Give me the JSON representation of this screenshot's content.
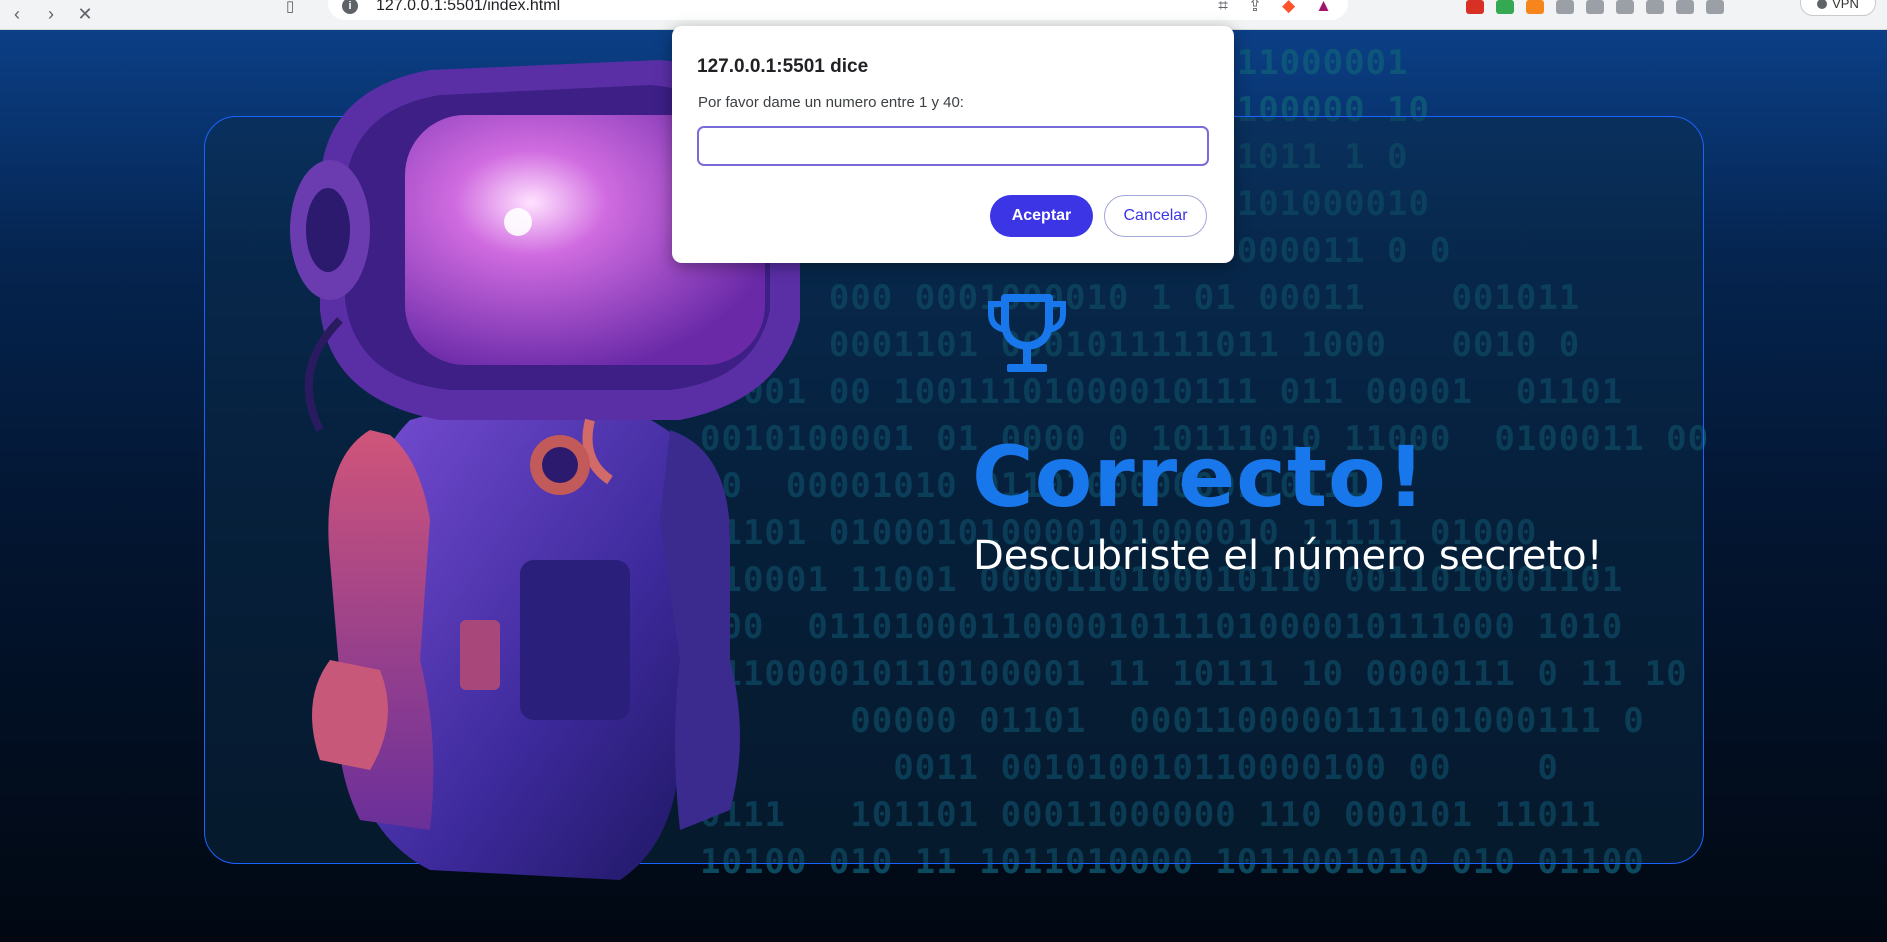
{
  "browser": {
    "url": "127.0.0.1:5501/index.html",
    "vpn_label": "VPN"
  },
  "background": {
    "binary_lines": [
      "           0 01101001011011000001",
      "           1000 010100100100000 10",
      "             0011000110011011 1 0",
      "           000101111  101101000010",
      "             011010001100000011 0 0",
      "      000 0001000010 1 01 00011    001011",
      "      0001101 0001011111011 1000   0010 0",
      "  001 00 10011101000010111 011 00001  01101",
      "0010100001 01 0000 0 10111010 11000  0100011 00",
      "10  00001010 011010000000110111",
      "01101 010001010000101000010 11111 01000",
      "110001 11001 0000110100010110 0011010001101",
      "000  011010001100001011101000010111000 1010",
      "111000010110100001 11 10111 10 0000111 0 11 10",
      "       00000 01101  0001100000111101000111 0",
      "         0011 001010010110000100 00    0",
      "0111   101101 00011000000 110 000101 11011",
      "10100 010 11 1011010000 1011001010 010 01100"
    ]
  },
  "dialog": {
    "title": "127.0.0.1:5501 dice",
    "message": "Por favor dame un numero entre 1 y 40:",
    "input_value": "",
    "ok_label": "Aceptar",
    "cancel_label": "Cancelar"
  },
  "result": {
    "title": "Correcto!",
    "subtitle": "Descubriste el número secreto!"
  },
  "colors": {
    "accent_title": "#1877ea",
    "card_border": "#1a63ff",
    "dialog_button": "#3c35e6"
  }
}
